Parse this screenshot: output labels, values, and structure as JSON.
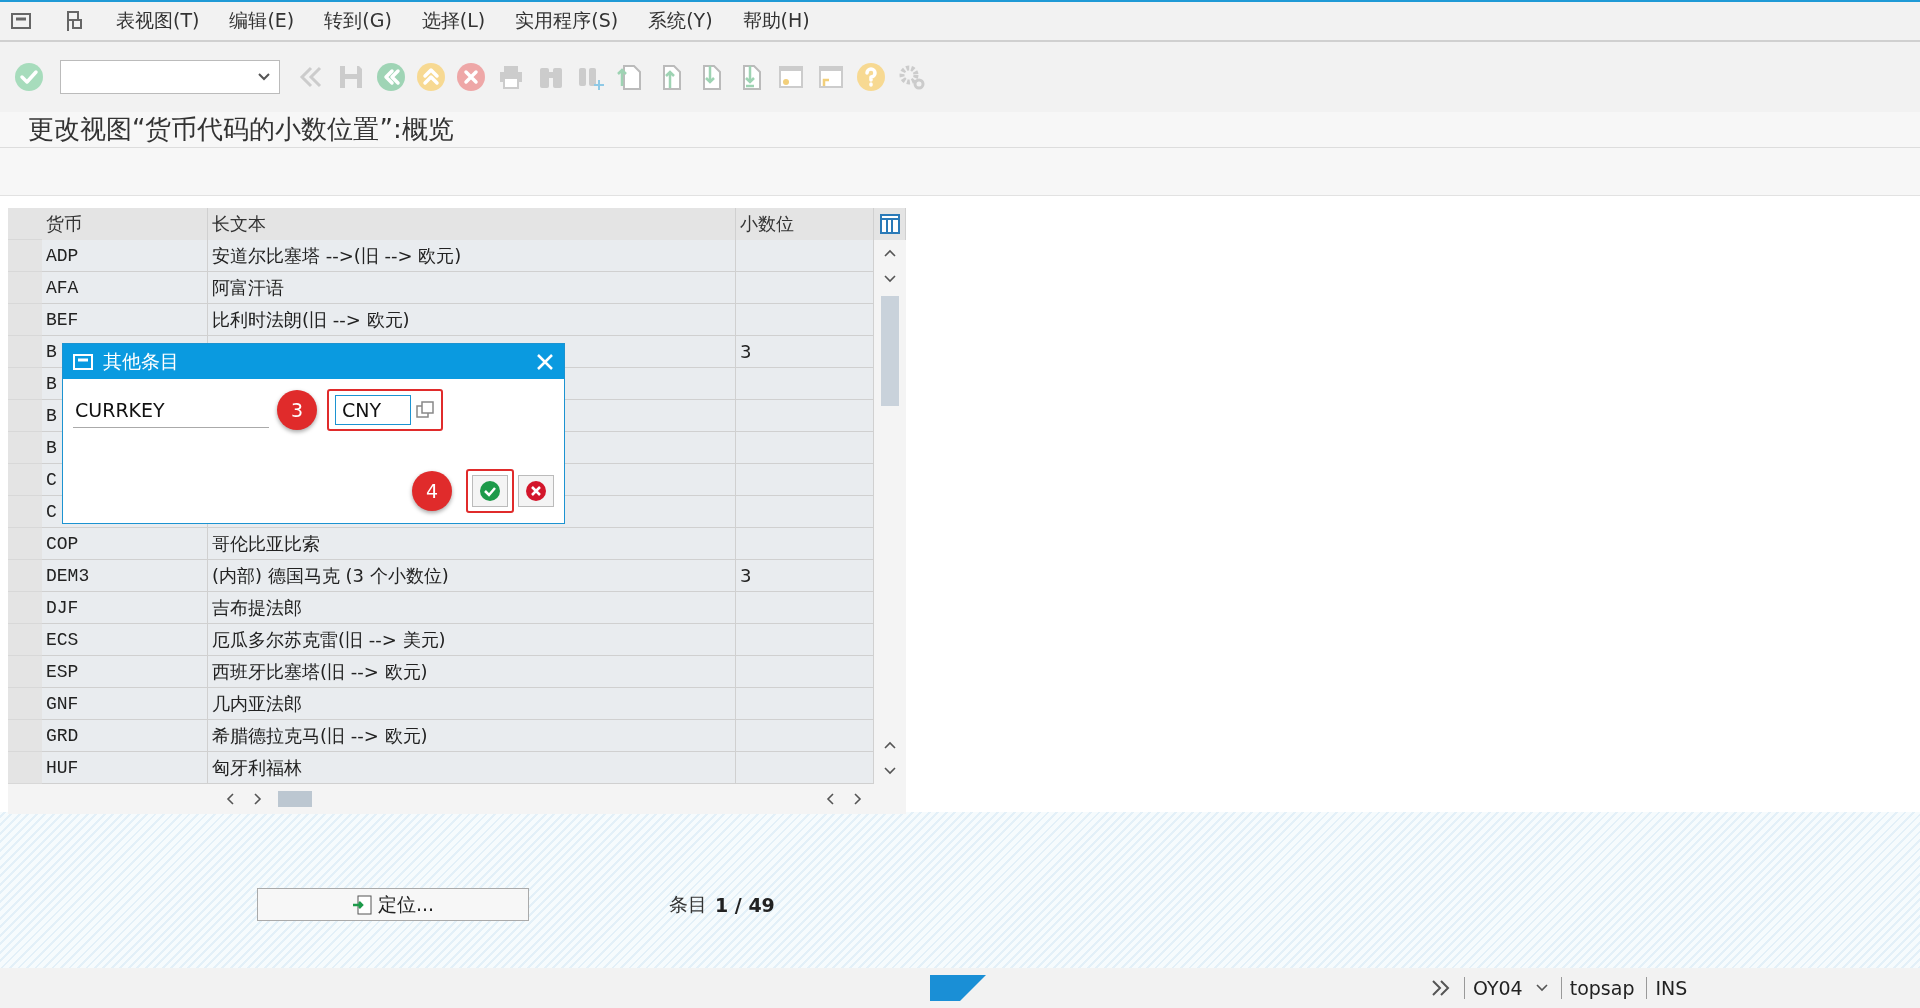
{
  "menu_bar": {
    "items": [
      "表视图(T)",
      "编辑(E)",
      "转到(G)",
      "选择(L)",
      "实用程序(S)",
      "系统(Y)",
      "帮助(H)"
    ]
  },
  "title": "更改视图“货币代码的小数位置”:概览",
  "table": {
    "columns": [
      "货币",
      "长文本",
      "小数位"
    ],
    "rows": [
      {
        "code": "ADP",
        "text": "安道尔比塞塔 -->(旧 --> 欧元)",
        "decimals": ""
      },
      {
        "code": "AFA",
        "text": "阿富汗语",
        "decimals": ""
      },
      {
        "code": "BEF",
        "text": "比利时法朗(旧 --> 欧元)",
        "decimals": ""
      },
      {
        "code": "B",
        "text": "",
        "decimals": "3"
      },
      {
        "code": "B",
        "text": "",
        "decimals": ""
      },
      {
        "code": "B",
        "text": "",
        "decimals": ""
      },
      {
        "code": "B",
        "text": "",
        "decimals": ""
      },
      {
        "code": "C",
        "text": "",
        "decimals": ""
      },
      {
        "code": "C",
        "text": "",
        "decimals": ""
      },
      {
        "code": "COP",
        "text": "哥伦比亚比索",
        "decimals": ""
      },
      {
        "code": "DEM3",
        "text": "(内部) 德国马克 (3 个小数位)",
        "decimals": "3"
      },
      {
        "code": "DJF",
        "text": "吉布提法郎",
        "decimals": ""
      },
      {
        "code": "ECS",
        "text": "厄瓜多尔苏克雷(旧 --> 美元)",
        "decimals": ""
      },
      {
        "code": "ESP",
        "text": "西班牙比塞塔(旧 --> 欧元)",
        "decimals": ""
      },
      {
        "code": "GNF",
        "text": "几内亚法郎",
        "decimals": ""
      },
      {
        "code": "GRD",
        "text": "希腊德拉克马(旧 --> 欧元)",
        "decimals": ""
      },
      {
        "code": "HUF",
        "text": "匈牙利福林",
        "decimals": ""
      }
    ]
  },
  "dialog": {
    "title": "其他条目",
    "field_label": "CURRKEY",
    "field_value": "CNY",
    "field_step": "3",
    "button_step": "4"
  },
  "footer": {
    "position_button": "定位...",
    "entries_label": "条目",
    "entries_value": "1 / 49"
  },
  "status_bar": {
    "transaction": "OY04",
    "system": "topsap",
    "mode": "INS"
  }
}
